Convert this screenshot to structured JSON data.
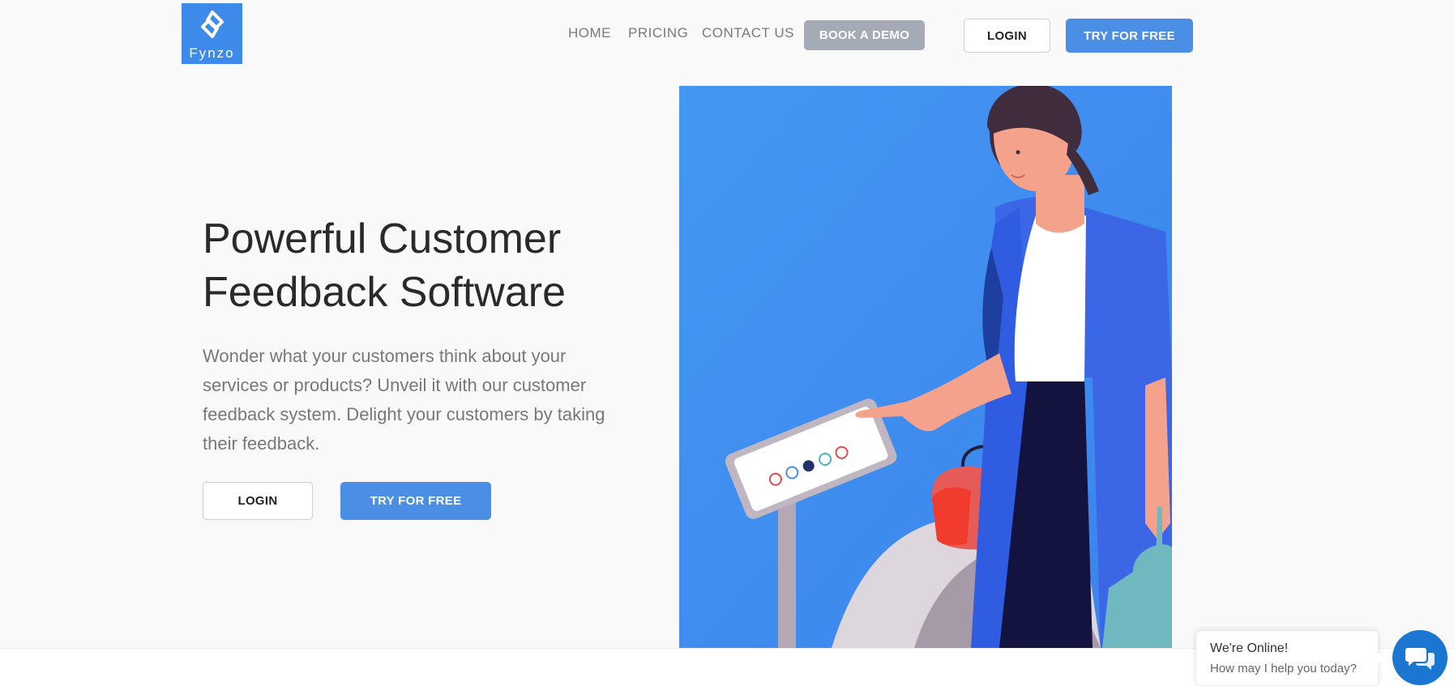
{
  "brand": {
    "name": "Fynzo",
    "color": "#3d8aea"
  },
  "nav": {
    "links": [
      {
        "label": "HOME"
      },
      {
        "label": "PRICING"
      },
      {
        "label": "CONTACT US"
      }
    ],
    "book_demo_label": "BOOK A DEMO",
    "login_label": "LOGIN",
    "try_free_label": "TRY FOR FREE"
  },
  "hero": {
    "title_line1": "Powerful Customer",
    "title_line2": "Feedback Software",
    "description": "Wonder what your customers think about your services or products? Unveil it with our customer feedback system. Delight your customers by taking their feedback.",
    "login_label": "LOGIN",
    "try_free_label": "TRY FOR FREE"
  },
  "chat": {
    "title": "We're Online!",
    "subtitle": "How may I help you today?",
    "icon": "chat-icon"
  },
  "colors": {
    "accent": "#4b8ee6",
    "demo_button": "#a4aab6",
    "illustration_bg": "#3f8ef0",
    "chat": "#1b76d2"
  }
}
